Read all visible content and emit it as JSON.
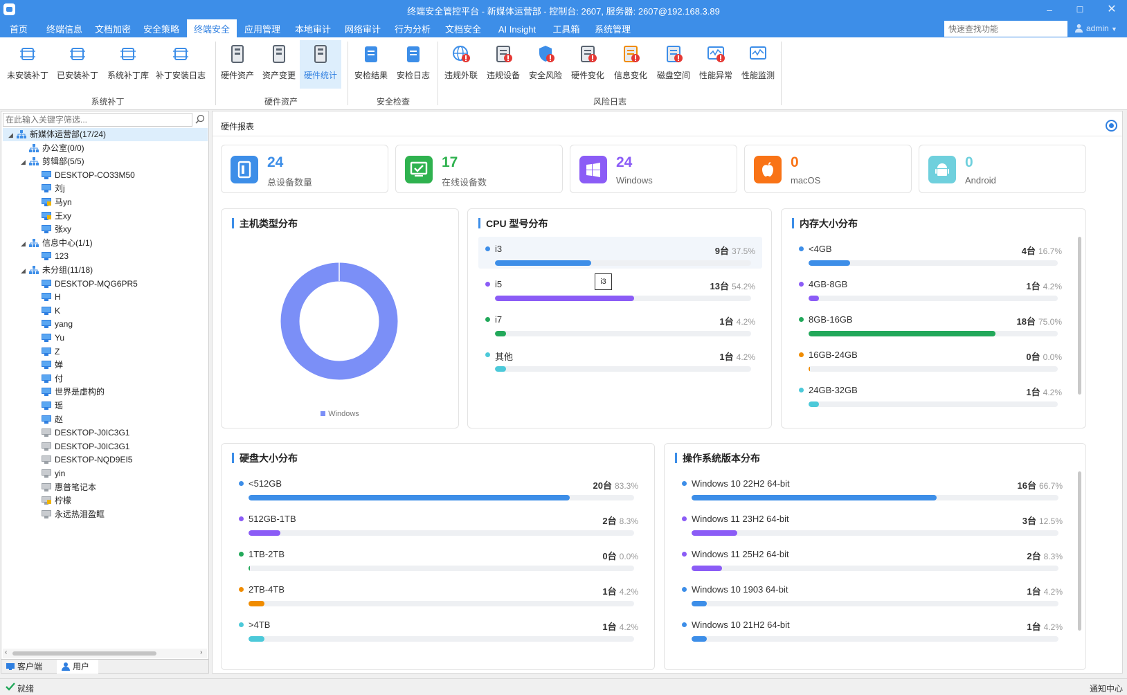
{
  "window": {
    "title": "终端安全管控平台 - 新媒体运营部 - 控制台: 2607, 服务器: 2607@192.168.3.89"
  },
  "menu": {
    "tabs": [
      "首页",
      "终端信息",
      "文档加密",
      "安全策略",
      "终端安全",
      "应用管理",
      "本地审计",
      "网络审计",
      "行为分析",
      "文档安全",
      "AI Insight",
      "工具箱",
      "系统管理"
    ],
    "active_index": 4,
    "search_placeholder": "快速查找功能",
    "user": "admin"
  },
  "ribbon": {
    "buttons": [
      "未安装补丁",
      "已安装补丁",
      "系统补丁库",
      "补丁安装日志",
      "硬件资产",
      "资产变更",
      "硬件统计",
      "安检结果",
      "安检日志",
      "违规外联",
      "违规设备",
      "安全风险",
      "硬件变化",
      "信息变化",
      "磁盘空间",
      "性能异常",
      "性能监测"
    ],
    "active_index": 6,
    "groups": [
      "系统补丁",
      "硬件资产",
      "安全检查",
      "风险日志"
    ]
  },
  "sidebar": {
    "filter_placeholder": "在此输入关键字筛选...",
    "tree": [
      {
        "label": "新媒体运营部(17/24)",
        "level": 0,
        "type": "group",
        "expanded": true,
        "selected": true
      },
      {
        "label": "办公室(0/0)",
        "level": 1,
        "type": "group"
      },
      {
        "label": "剪辑部(5/5)",
        "level": 1,
        "type": "group",
        "expanded": true
      },
      {
        "label": "DESKTOP-CO33M50",
        "level": 2,
        "type": "pc-online"
      },
      {
        "label": "刘j",
        "level": 2,
        "type": "pc-online"
      },
      {
        "label": "马yn",
        "level": 2,
        "type": "pc-warn"
      },
      {
        "label": "王xy",
        "level": 2,
        "type": "pc-warn"
      },
      {
        "label": "张xy",
        "level": 2,
        "type": "pc-online"
      },
      {
        "label": "信息中心(1/1)",
        "level": 1,
        "type": "group",
        "expanded": true
      },
      {
        "label": "123",
        "level": 2,
        "type": "pc-online"
      },
      {
        "label": "未分组(11/18)",
        "level": 1,
        "type": "group",
        "expanded": true
      },
      {
        "label": "DESKTOP-MQG6PR5",
        "level": 2,
        "type": "pc-online"
      },
      {
        "label": "H",
        "level": 2,
        "type": "pc-online"
      },
      {
        "label": "K",
        "level": 2,
        "type": "pc-online"
      },
      {
        "label": "yang",
        "level": 2,
        "type": "pc-online"
      },
      {
        "label": "Yu",
        "level": 2,
        "type": "pc-online"
      },
      {
        "label": "Z",
        "level": 2,
        "type": "pc-online"
      },
      {
        "label": "婵",
        "level": 2,
        "type": "pc-online"
      },
      {
        "label": "付",
        "level": 2,
        "type": "pc-online"
      },
      {
        "label": "世界是虚构的",
        "level": 2,
        "type": "pc-online"
      },
      {
        "label": "瑶",
        "level": 2,
        "type": "pc-online"
      },
      {
        "label": "赵",
        "level": 2,
        "type": "pc-online"
      },
      {
        "label": "DESKTOP-J0IC3G1",
        "level": 2,
        "type": "pc-offline"
      },
      {
        "label": "DESKTOP-J0IC3G1",
        "level": 2,
        "type": "pc-offline"
      },
      {
        "label": "DESKTOP-NQD9EI5",
        "level": 2,
        "type": "pc-offline"
      },
      {
        "label": "yin",
        "level": 2,
        "type": "pc-offline"
      },
      {
        "label": "惠普笔记本",
        "level": 2,
        "type": "pc-offline"
      },
      {
        "label": "柠檬",
        "level": 2,
        "type": "pc-offline-warn"
      },
      {
        "label": "永远热泪盈眶",
        "level": 2,
        "type": "pc-offline"
      }
    ],
    "tabs": [
      "客户端",
      "用户"
    ],
    "active_tab": 1
  },
  "main": {
    "title": "硬件报表",
    "stats": [
      {
        "value": "24",
        "label": "总设备数量",
        "color": "#3d8ee8",
        "icon": "device-icon"
      },
      {
        "value": "17",
        "label": "在线设备数",
        "color": "#2fb24f",
        "icon": "online-monitor-icon"
      },
      {
        "value": "24",
        "label": "Windows",
        "color": "#8b5cf6",
        "icon": "windows-icon"
      },
      {
        "value": "0",
        "label": "macOS",
        "color": "#f97316",
        "icon": "apple-icon"
      },
      {
        "value": "0",
        "label": "Android",
        "color": "#6fd0dd",
        "icon": "android-icon"
      }
    ],
    "host_panel": {
      "title": "主机类型分布",
      "legend": "Windows"
    },
    "cpu_panel": {
      "title": "CPU 型号分布",
      "tooltip": "i3",
      "rows": [
        {
          "label": "i3",
          "count": "9台",
          "pct": "37.5%",
          "value": 0.375,
          "color": "#3d8ee8"
        },
        {
          "label": "i5",
          "count": "13台",
          "pct": "54.2%",
          "value": 0.542,
          "color": "#8b5cf6"
        },
        {
          "label": "i7",
          "count": "1台",
          "pct": "4.2%",
          "value": 0.042,
          "color": "#22a85a"
        },
        {
          "label": "其他",
          "count": "1台",
          "pct": "4.2%",
          "value": 0.042,
          "color": "#4cc9d9"
        }
      ]
    },
    "mem_panel": {
      "title": "内存大小分布",
      "rows": [
        {
          "label": "<4GB",
          "count": "4台",
          "pct": "16.7%",
          "value": 0.167,
          "color": "#3d8ee8"
        },
        {
          "label": "4GB-8GB",
          "count": "1台",
          "pct": "4.2%",
          "value": 0.042,
          "color": "#8b5cf6"
        },
        {
          "label": "8GB-16GB",
          "count": "18台",
          "pct": "75.0%",
          "value": 0.75,
          "color": "#22a85a"
        },
        {
          "label": "16GB-24GB",
          "count": "0台",
          "pct": "0.0%",
          "value": 0.0,
          "color": "#f08c00"
        },
        {
          "label": "24GB-32GB",
          "count": "1台",
          "pct": "4.2%",
          "value": 0.042,
          "color": "#4cc9d9"
        }
      ]
    },
    "disk_panel": {
      "title": "硬盘大小分布",
      "rows": [
        {
          "label": "<512GB",
          "count": "20台",
          "pct": "83.3%",
          "value": 0.833,
          "color": "#3d8ee8"
        },
        {
          "label": "512GB-1TB",
          "count": "2台",
          "pct": "8.3%",
          "value": 0.083,
          "color": "#8b5cf6"
        },
        {
          "label": "1TB-2TB",
          "count": "0台",
          "pct": "0.0%",
          "value": 0.0,
          "color": "#22a85a"
        },
        {
          "label": "2TB-4TB",
          "count": "1台",
          "pct": "4.2%",
          "value": 0.042,
          "color": "#f08c00"
        },
        {
          "label": ">4TB",
          "count": "1台",
          "pct": "4.2%",
          "value": 0.042,
          "color": "#4cc9d9"
        }
      ]
    },
    "os_panel": {
      "title": "操作系统版本分布",
      "rows": [
        {
          "label": "Windows 10 22H2 64-bit",
          "count": "16台",
          "pct": "66.7%",
          "value": 0.667,
          "color": "#3d8ee8"
        },
        {
          "label": "Windows 11 23H2 64-bit",
          "count": "3台",
          "pct": "12.5%",
          "value": 0.125,
          "color": "#8b5cf6"
        },
        {
          "label": "Windows 11 25H2 64-bit",
          "count": "2台",
          "pct": "8.3%",
          "value": 0.083,
          "color": "#8b5cf6"
        },
        {
          "label": "Windows 10 1903 64-bit",
          "count": "1台",
          "pct": "4.2%",
          "value": 0.042,
          "color": "#3d8ee8"
        },
        {
          "label": "Windows 10 21H2 64-bit",
          "count": "1台",
          "pct": "4.2%",
          "value": 0.042,
          "color": "#3d8ee8"
        }
      ]
    }
  },
  "chart_data": {
    "type": "pie",
    "categories": [
      "Windows"
    ],
    "values": [
      24
    ],
    "title": "主机类型分布"
  },
  "status": {
    "text": "就绪",
    "notify": "通知中心"
  }
}
